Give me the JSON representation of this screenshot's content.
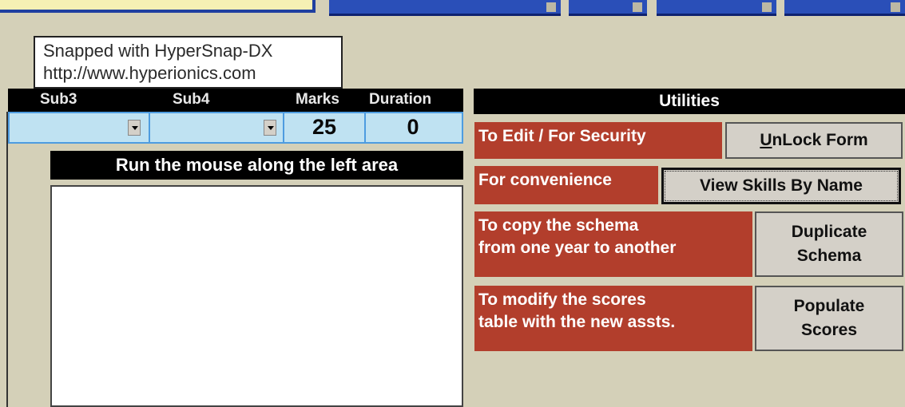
{
  "tooltip": {
    "line1": "Snapped with HyperSnap-DX",
    "line2": "http://www.hyperionics.com"
  },
  "columns": {
    "sub3": "Sub3",
    "sub4": "Sub4",
    "marks": "Marks",
    "duration": "Duration"
  },
  "row": {
    "sub3_value": "",
    "sub4_value": "",
    "marks_value": "25",
    "duration_value": "0"
  },
  "run_area": {
    "heading": "Run the mouse along the left area"
  },
  "utilities": {
    "heading": "Utilities",
    "items": [
      {
        "description": "To Edit / For Security",
        "button_access_key": "U",
        "button_rest": "nLock Form"
      },
      {
        "description": "For convenience",
        "button": "View Skills By Name"
      },
      {
        "description_line1": "To copy the schema",
        "description_line2": "from one year to another",
        "button_line1": "Duplicate",
        "button_line2": "Schema"
      },
      {
        "description_line1": "To modify the scores",
        "description_line2": "table with the new assts.",
        "button_line1": "Populate",
        "button_line2": "Scores"
      }
    ]
  },
  "colors": {
    "form_background": "#d4d0b8",
    "label_red": "#b23e2c",
    "header_black": "#000000",
    "input_light_blue": "#bfe2f2",
    "button_gray": "#d4d0c8"
  }
}
